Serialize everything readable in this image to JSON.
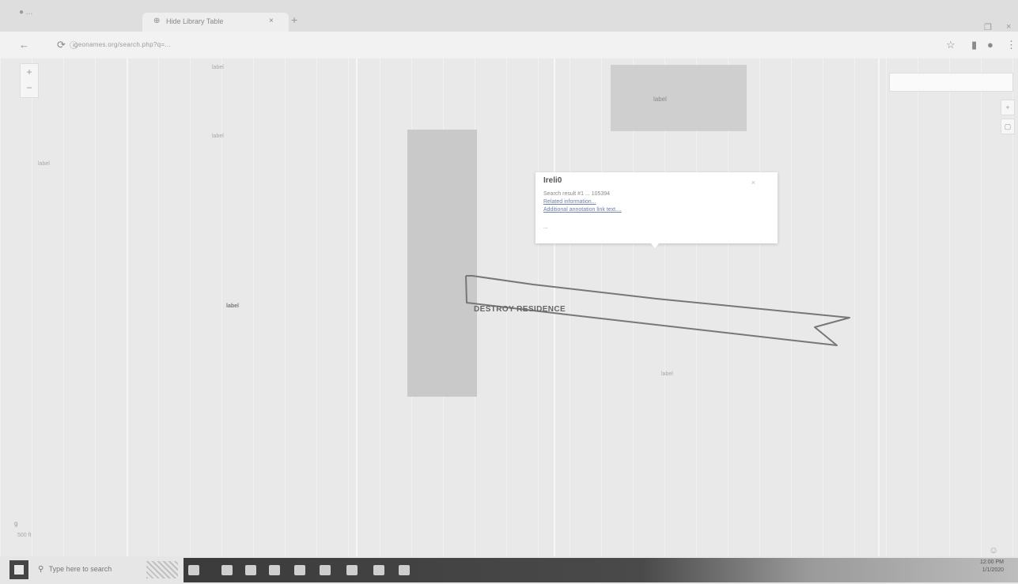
{
  "browser": {
    "inactive_tab_label": "...",
    "active_tab_title": "Hide Library Table",
    "new_tab_icon": "plus-icon",
    "url": "geonames.org/search.php?q=...",
    "toolbar_icons": [
      "back-icon",
      "reload-icon",
      "info-icon",
      "star-icon",
      "extension-icon",
      "account-icon",
      "menu-icon"
    ]
  },
  "map": {
    "zoom_in": "+",
    "zoom_out": "−",
    "highlighted_area_label": "label",
    "labels": [
      {
        "text": "label",
        "bold": false
      },
      {
        "text": "label",
        "bold": false
      },
      {
        "text": "label",
        "bold": false
      },
      {
        "text": "label",
        "bold": true
      },
      {
        "text": "label",
        "bold": false
      },
      {
        "text": "label",
        "bold": false
      }
    ],
    "scale_text": "500 ft",
    "google_logo": "g"
  },
  "popup": {
    "title": "Ireli0",
    "lines": [
      {
        "text": "Search result #1 ... 105394",
        "link": false
      },
      {
        "text": "Related information...",
        "link": true
      },
      {
        "text": "Additional annotation link text....",
        "link": true
      },
      {
        "text": "...",
        "link": false
      }
    ],
    "close_icon": "×"
  },
  "annotation": {
    "text": "DESTROY RESIDENCE"
  },
  "taskbar": {
    "search_placeholder": "Type here to search",
    "clock_time": "12:00 PM",
    "clock_date": "1/1/2020",
    "app_icons": [
      "task-view-icon",
      "edge-icon",
      "file-explorer-icon",
      "store-icon",
      "mail-icon",
      "chrome-icon",
      "word-icon",
      "calculator-icon",
      "notes-icon"
    ]
  },
  "colors": {
    "map_bg": "#e9e9e9",
    "block_fill": "#c9c9c9",
    "taskbar_dark": "#3b3b3b"
  }
}
